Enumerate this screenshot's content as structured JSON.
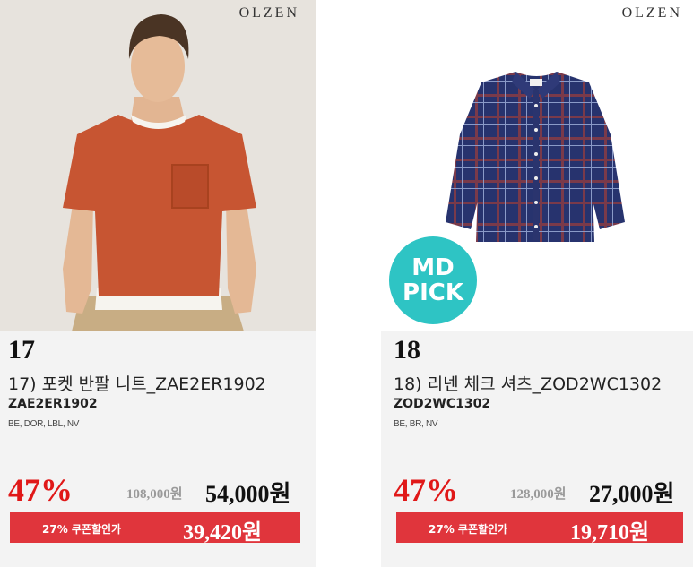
{
  "products": [
    {
      "brand": "OLZEN",
      "rank": "17",
      "name": "17) 포켓 반팔 니트_ZAE2ER1902",
      "code": "ZAE2ER1902",
      "colors": "BE, DOR, LBL, NV",
      "discount": "47%",
      "original_price": "108,000원",
      "sale_price": "54,000원",
      "coupon_label": "27% 쿠폰할인가",
      "coupon_price": "39,420원",
      "image_icon": "model-wearing-knit-image"
    },
    {
      "brand": "OLZEN",
      "rank": "18",
      "name": "18) 리넨 체크 셔츠_ZOD2WC1302",
      "code": "ZOD2WC1302",
      "colors": "BE, BR, NV",
      "discount": "47%",
      "original_price": "128,000원",
      "sale_price": "27,000원",
      "coupon_label": "27% 쿠폰할인가",
      "coupon_price": "19,710원",
      "badge_line1": "MD",
      "badge_line2": "PICK",
      "image_icon": "check-shirt-image"
    }
  ],
  "colors": {
    "discount_red": "#e01818",
    "coupon_bar": "#e0353c",
    "md_pick_badge": "#2ec4c4",
    "card_background": "#f3f3f3"
  }
}
